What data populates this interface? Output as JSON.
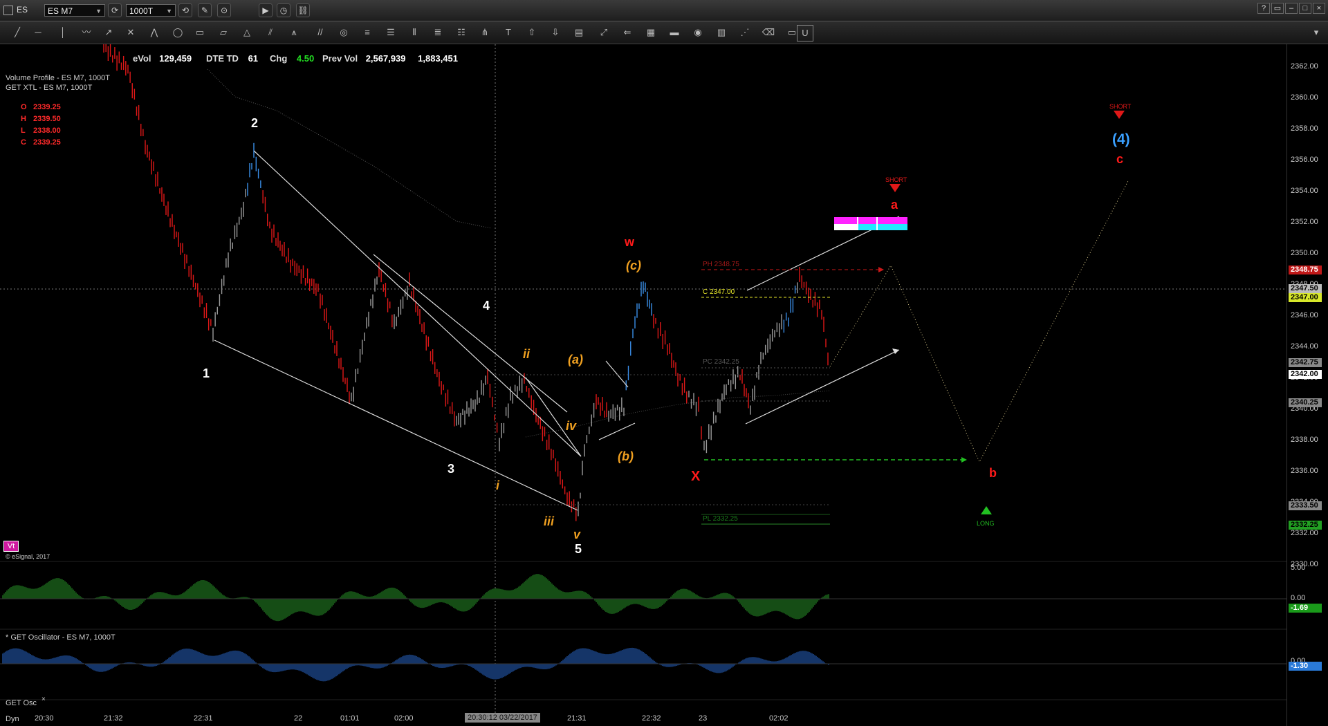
{
  "window": {
    "symbol": "ES",
    "symbol_combo": "ES M7",
    "interval_combo": "1000T"
  },
  "header": {
    "evol_label": "eVol",
    "evol": "129,459",
    "dte_label": "DTE TD",
    "dte": "61",
    "chg_label": "Chg",
    "chg": "4.50",
    "prevvol_label": "Prev Vol",
    "prevvol": "2,567,939",
    "vol2": "1,883,451"
  },
  "studies": {
    "volume_profile": "Volume Profile - ES M7, 1000T",
    "get_xtl": "GET XTL - ES M7, 1000T",
    "ohlc": [
      {
        "k": "O",
        "v": "2339.25"
      },
      {
        "k": "H",
        "v": "2339.50"
      },
      {
        "k": "L",
        "v": "2338.00"
      },
      {
        "k": "C",
        "v": "2339.25"
      }
    ],
    "vt_badge": "Vt",
    "copyright": "© eSignal, 2017",
    "osc_title": "* GET Oscillator - ES M7, 1000T",
    "osc_tab": "GET Osc",
    "dyn": "Dyn"
  },
  "overlays": {
    "ph": "PH 2348.75",
    "c": "C 2347.00",
    "pc": "PC 2342.25",
    "pl": "PL 2332.25",
    "short1": "SHORT",
    "short2": "SHORT",
    "long": "LONG"
  },
  "waves": {
    "w1": "1",
    "w2": "2",
    "w3": "3",
    "w4": "4",
    "w5": "5",
    "i": "i",
    "ii": "ii",
    "iii": "iii",
    "iv": "iv",
    "v": "v",
    "a_paren": "(a)",
    "b_paren": "(b)",
    "c_paren": "(c)",
    "w": "w",
    "x": "X",
    "a": "a",
    "b": "b",
    "c": "c",
    "four": "(4)"
  },
  "price_axis": [
    "2362.00",
    "2360.00",
    "2358.00",
    "2356.00",
    "2354.00",
    "2352.00",
    "2350.00",
    "2348.00",
    "2346.00",
    "2344.00",
    "2342.00",
    "2340.00",
    "2338.00",
    "2336.00",
    "2334.00",
    "2332.00",
    "2330.00"
  ],
  "price_tags": {
    "t1": "2348.75",
    "t2": "2347.50",
    "t3": "2347.00",
    "t4": "2342.75",
    "t5": "2342.00",
    "t6": "2340.25",
    "t7": "2333.50",
    "t8": "2332.25"
  },
  "osc_axis": {
    "top": "5.00",
    "zero": "0.00",
    "val": "-1.69",
    "zero2": "0.00",
    "val2": "-1.30"
  },
  "time_axis": [
    "20:30",
    "21:32",
    "22:31",
    "22",
    "01:01",
    "02:00",
    "21:31",
    "22:32",
    "23",
    "02:02"
  ],
  "cursor_time": "20:30:12 03/22/2017",
  "colors": {
    "bull": "#3a8ee8",
    "bear": "#e01818",
    "neutral": "#9a9a9a",
    "accent_red": "#ff1a1a"
  }
}
